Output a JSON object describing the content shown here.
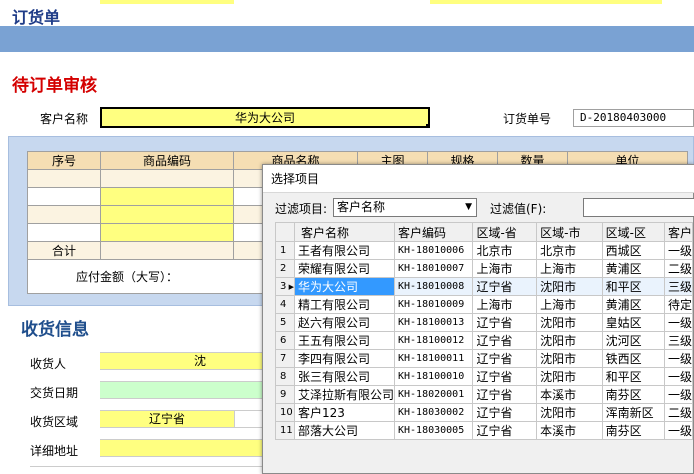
{
  "header": {
    "title": "订货单"
  },
  "top_strip_colors": [
    "#ffffff",
    "#ffff80",
    "#ffffff",
    "#ffff80",
    "#ffffff"
  ],
  "review": {
    "title": "待订单审核",
    "customer_label": "客户名称",
    "customer_value": "华为大公司",
    "order_no_label": "订货单号",
    "order_no_value": "D-20180403000"
  },
  "order_table": {
    "columns": [
      "序号",
      "商品编码",
      "商品名称",
      "主图",
      "规格",
      "数量",
      "单位"
    ],
    "total_label": "合计",
    "amount_label": "应付金额（大写）："
  },
  "receive": {
    "title": "收货信息",
    "receiver_label": "收货人",
    "receiver_value": "沈",
    "date_label": "交货日期",
    "region_label": "收货区域",
    "region_value": "辽宁省",
    "address_label": "详细地址"
  },
  "dialog": {
    "title": "选择项目",
    "filter_label": "过滤项目:",
    "filter_selected": "客户名称",
    "filter_value_label": "过滤值(F):",
    "columns": [
      "客户名称",
      "客户编码",
      "区域-省",
      "区域-市",
      "区域-区",
      "客户"
    ],
    "selected_row": 3,
    "rows": [
      [
        "1",
        "王者有限公司",
        "KH-18010006",
        "北京市",
        "北京市",
        "西城区",
        "一级"
      ],
      [
        "2",
        "荣耀有限公司",
        "KH-18010007",
        "上海市",
        "上海市",
        "黄浦区",
        "二级"
      ],
      [
        "3",
        "华为大公司",
        "KH-18010008",
        "辽宁省",
        "沈阳市",
        "和平区",
        "三级"
      ],
      [
        "4",
        "精工有限公司",
        "KH-18010009",
        "上海市",
        "上海市",
        "黄浦区",
        "待定"
      ],
      [
        "5",
        "赵六有限公司",
        "KH-18100013",
        "辽宁省",
        "沈阳市",
        "皇姑区",
        "一级"
      ],
      [
        "6",
        "王五有限公司",
        "KH-18100012",
        "辽宁省",
        "沈阳市",
        "沈河区",
        "三级"
      ],
      [
        "7",
        "李四有限公司",
        "KH-18100011",
        "辽宁省",
        "沈阳市",
        "铁西区",
        "一级"
      ],
      [
        "8",
        "张三有限公司",
        "KH-18100010",
        "辽宁省",
        "沈阳市",
        "和平区",
        "一级"
      ],
      [
        "9",
        "艾泽拉斯有限公司",
        "KH-18020001",
        "辽宁省",
        "本溪市",
        "南芬区",
        "一级"
      ],
      [
        "10",
        "客户123",
        "KH-18030002",
        "辽宁省",
        "沈阳市",
        "浑南新区",
        "二级"
      ],
      [
        "11",
        "部落大公司",
        "KH-18030005",
        "辽宁省",
        "本溪市",
        "南芬区",
        "一级"
      ]
    ]
  }
}
